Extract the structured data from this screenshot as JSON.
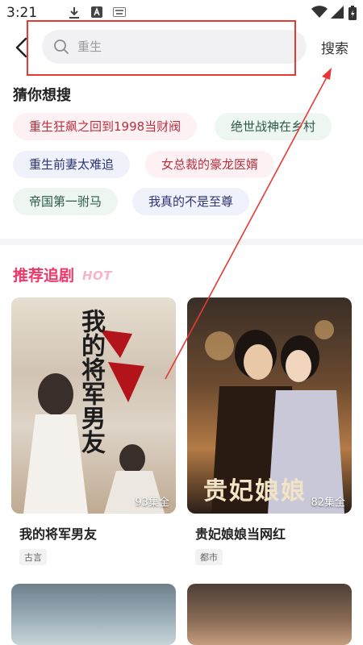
{
  "status_bar": {
    "time": "3:21",
    "icons": [
      "download-icon",
      "a-notification-icon",
      "keyboard-icon",
      "wifi-icon",
      "signal-icon",
      "battery-charging-icon"
    ]
  },
  "header": {
    "back_icon": "chevron-left-icon",
    "search": {
      "placeholder": "重生",
      "value": ""
    },
    "search_button_label": "搜索"
  },
  "suggestions": {
    "title": "猜你想搜",
    "items": [
      {
        "label": "重生狂飙之回到1998当财阀"
      },
      {
        "label": "绝世战神在乡村"
      },
      {
        "label": "重生前妻太难追"
      },
      {
        "label": "女总裁的豪龙医婿"
      },
      {
        "label": "帝国第一驸马"
      },
      {
        "label": "我真的不是至尊"
      }
    ]
  },
  "recommend": {
    "title": "推荐追剧",
    "badge": "HOT",
    "items": [
      {
        "title": "我的将军男友",
        "episodes": "93集全",
        "tag": "古言",
        "poster_text": "我的将军男友"
      },
      {
        "title": "贵妃娘娘当网红",
        "episodes": "82集全",
        "tag": "都市",
        "poster_text": "贵妃娘娘"
      },
      {
        "title": "",
        "episodes": "",
        "tag": ""
      },
      {
        "title": "",
        "episodes": "",
        "tag": ""
      }
    ]
  },
  "colors": {
    "accent": "#f1366a",
    "annotation": "#e53935",
    "chip_pink_text": "#b63140",
    "chip_green_text": "#2b5a48",
    "chip_blue_text": "#2e3473"
  }
}
